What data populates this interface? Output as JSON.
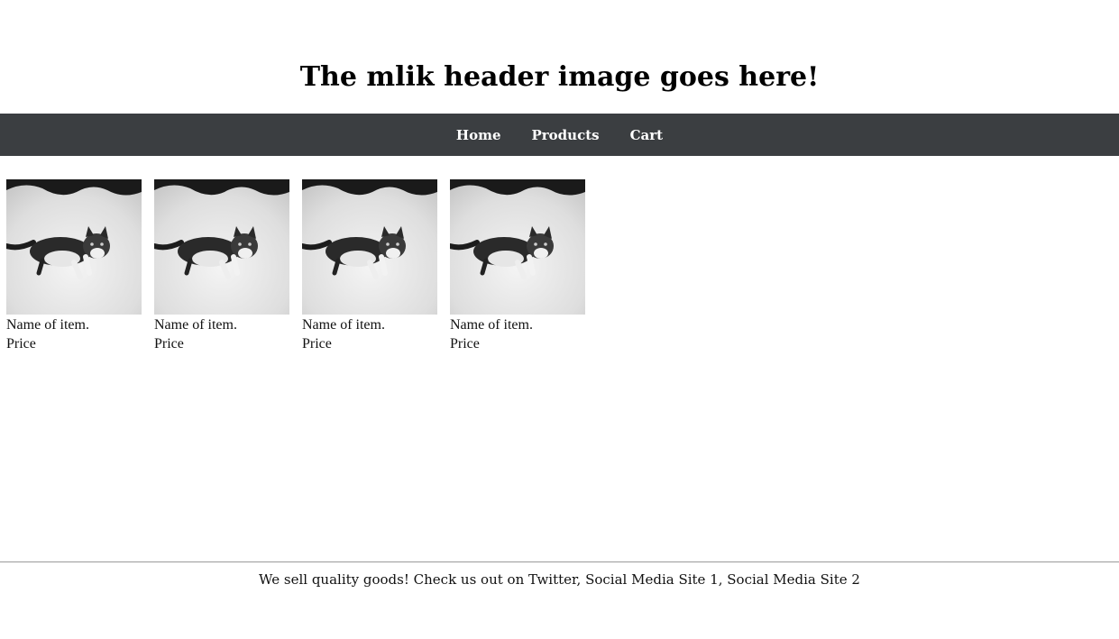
{
  "header": {
    "title": "The mlik header image goes here!"
  },
  "nav": {
    "items": [
      {
        "label": "Home"
      },
      {
        "label": "Products"
      },
      {
        "label": "Cart"
      }
    ]
  },
  "products": [
    {
      "name": "Name of item.",
      "price": "Price"
    },
    {
      "name": "Name of item.",
      "price": "Price"
    },
    {
      "name": "Name of item.",
      "price": "Price"
    },
    {
      "name": "Name of item.",
      "price": "Price"
    }
  ],
  "footer": {
    "text": "We sell quality goods! Check us out on Twitter, Social Media Site 1, Social Media Site 2"
  },
  "colors": {
    "navbar": "#3b3e41",
    "nav_text": "#ffffff",
    "footer_rule": "#9a9a9a"
  }
}
